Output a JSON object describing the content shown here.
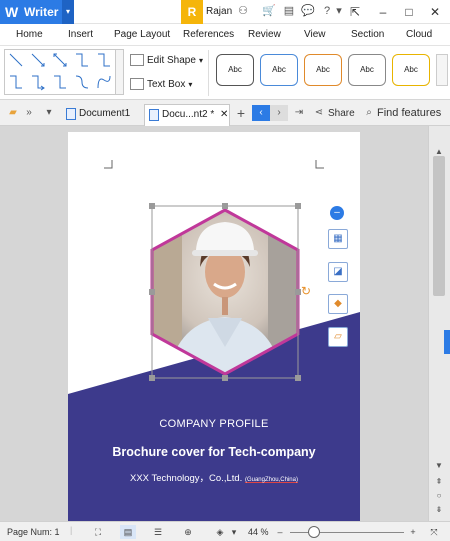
{
  "titlebar": {
    "app_name": "Writer",
    "user_initial": "R",
    "user_name": "Rajan"
  },
  "menu": {
    "items": [
      "Home",
      "Insert",
      "Page Layout",
      "References",
      "Review",
      "View",
      "Section",
      "Cloud"
    ]
  },
  "ribbon": {
    "edit_shape": "Edit Shape",
    "text_box": "Text Box",
    "style_label": "Abc",
    "style_colors": [
      "#555555",
      "#4a8ad9",
      "#e08a2b",
      "#888888",
      "#e8b400"
    ]
  },
  "tabs": {
    "doc1": "Document1",
    "doc2": "Docu...nt2 *",
    "share": "Share",
    "find": "Find features"
  },
  "page": {
    "company_profile": "COMPANY PROFILE",
    "headline": "Brochure cover for Tech-company",
    "company_line": "XXX Technology，Co.,Ltd.",
    "location": "(GuangZhou,China)",
    "band_color": "#3d3a8c",
    "frame_color": "#c0389a"
  },
  "status": {
    "page_num": "Page Num: 1",
    "zoom": "44 %"
  }
}
